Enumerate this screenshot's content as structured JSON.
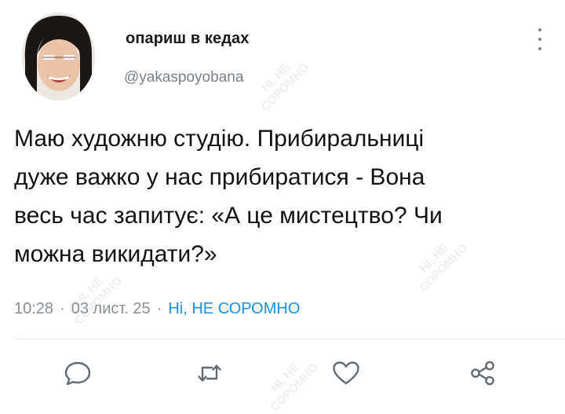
{
  "tweet": {
    "display_name": "опариш в кедах",
    "handle": "@yakaspoyobana",
    "text": "Маю художню студію. Прибиральниці\nдуже важко у нас прибиратися - Вона\nвесь час запитує: «А це мистецтво? Чи\nможна викидати?»",
    "time": "10:28",
    "date": "03 лист. 25",
    "separator": "·",
    "source": "Ні, НЕ СОРОМНО"
  },
  "actions": [
    {
      "name": "reply",
      "icon": "comment-icon"
    },
    {
      "name": "retweet",
      "icon": "retweet-icon"
    },
    {
      "name": "like",
      "icon": "heart-icon"
    },
    {
      "name": "share",
      "icon": "share-icon"
    }
  ],
  "watermark": {
    "text": "НІ, НЕ\nСОРОМНО"
  },
  "colors": {
    "text": "#121212",
    "muted": "#8a8f95",
    "link": "#1d8fe3",
    "icon": "#7d8389",
    "divider": "#e6e8eb"
  }
}
